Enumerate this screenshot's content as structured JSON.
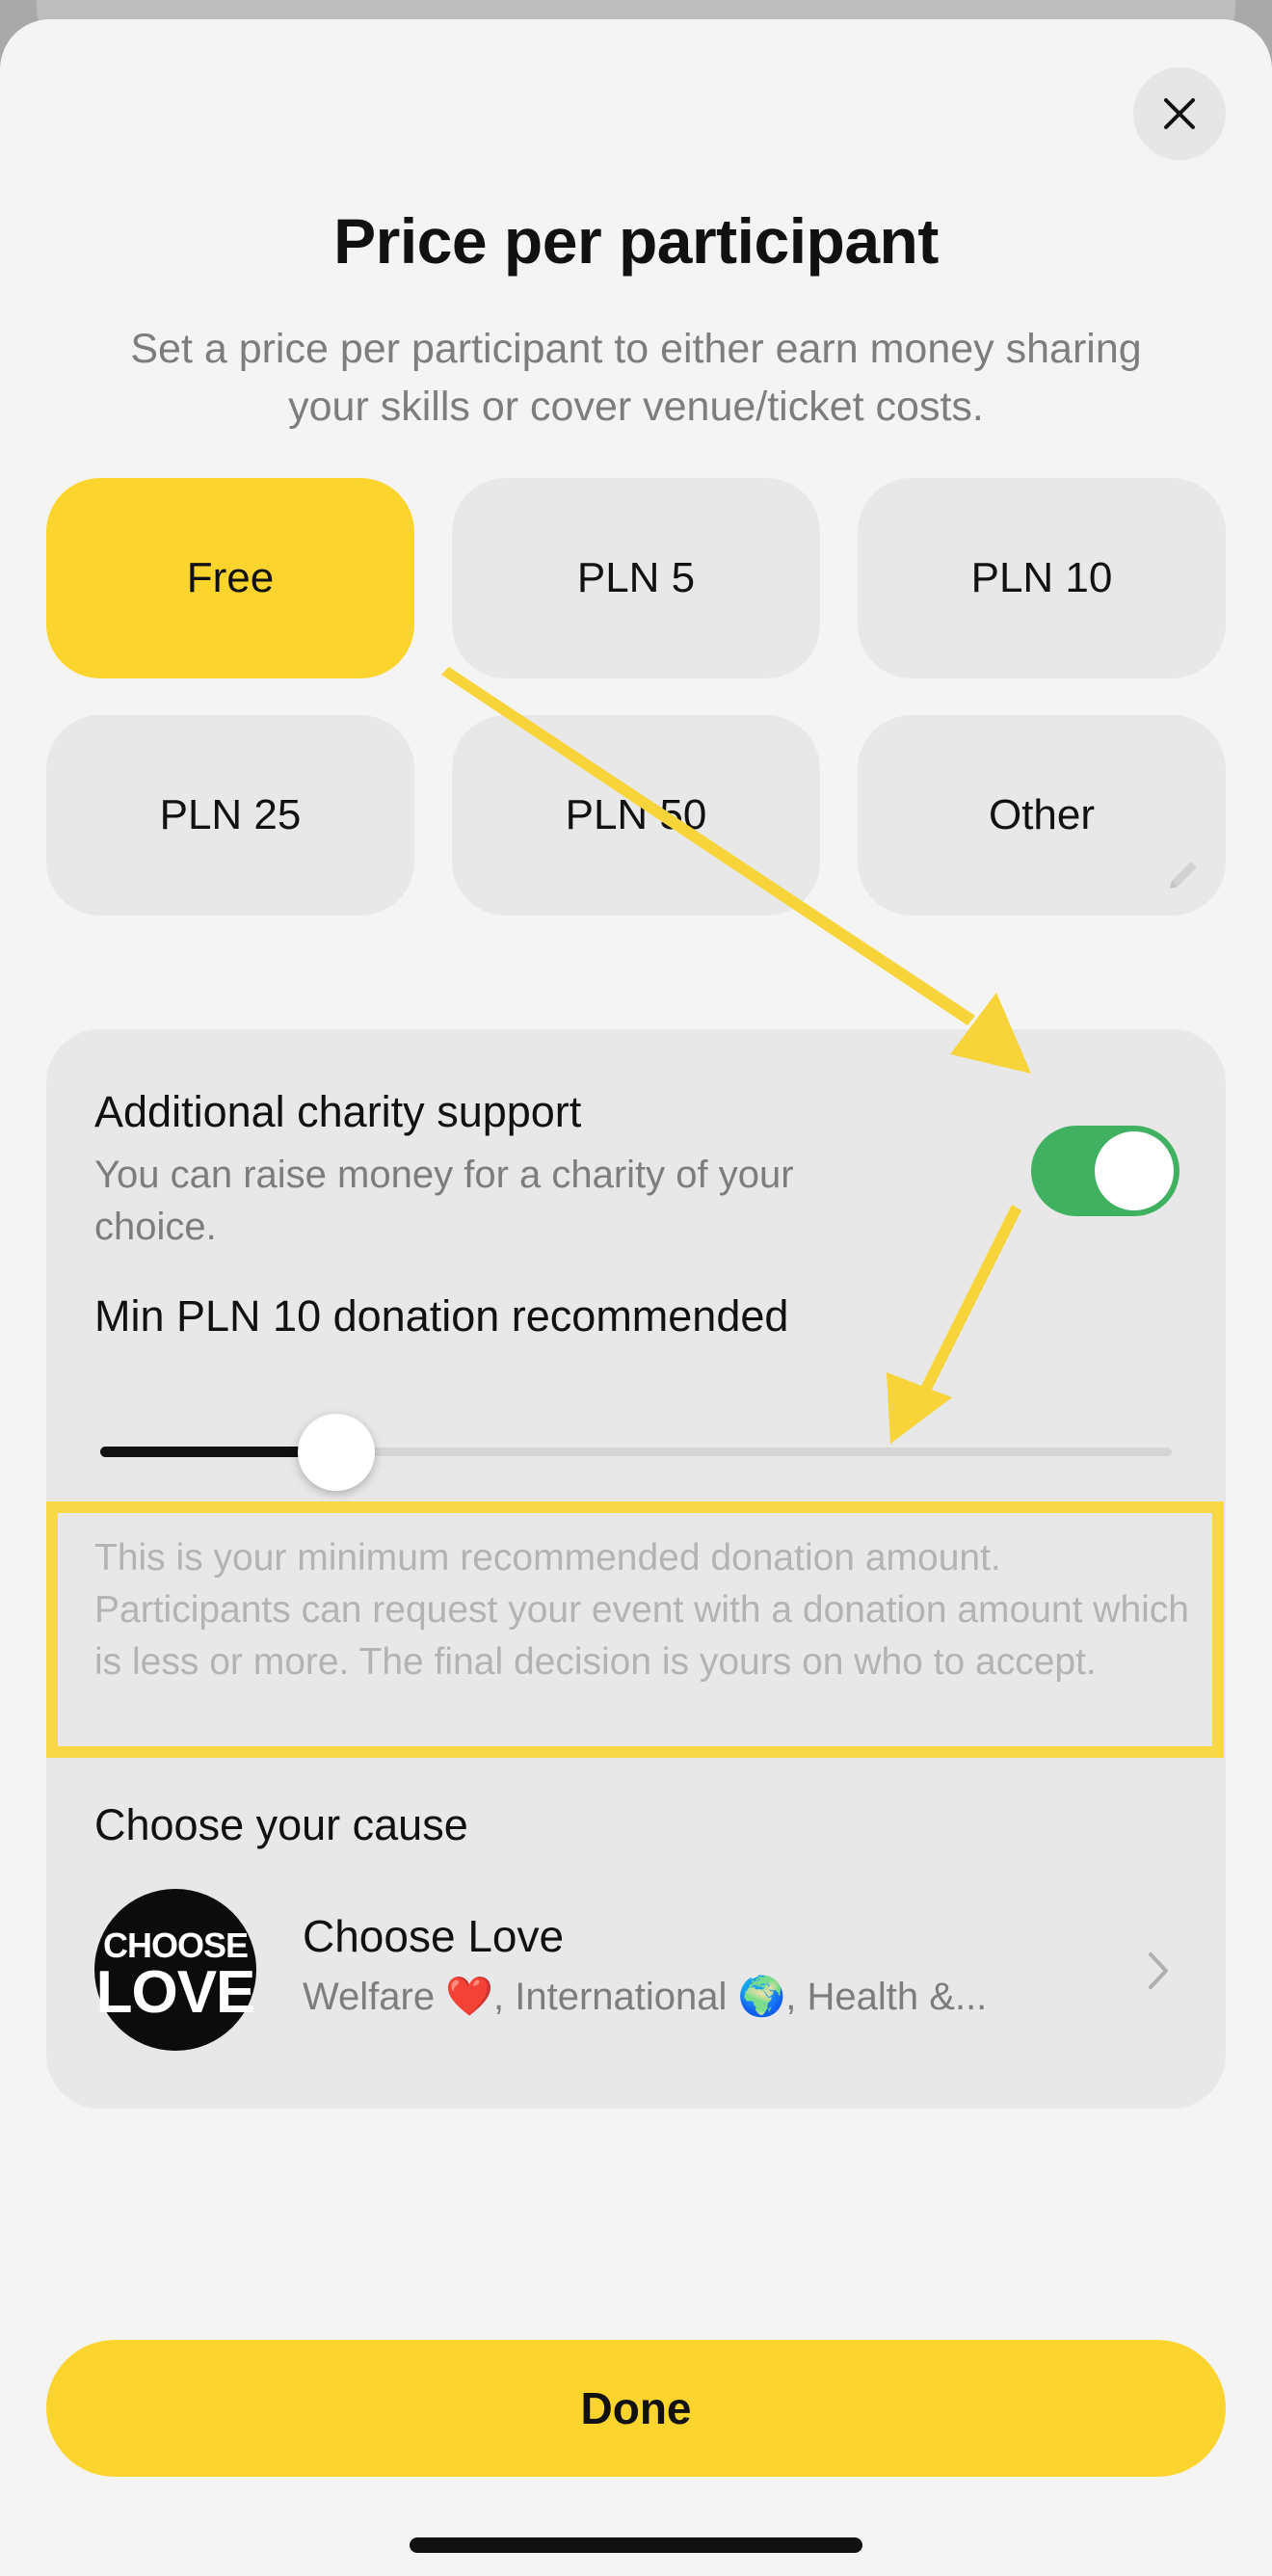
{
  "header": {
    "title": "Price per participant",
    "subtitle": "Set a price per participant to either earn money sharing your skills or cover venue/ticket costs."
  },
  "price_options": [
    {
      "label": "Free",
      "selected": true
    },
    {
      "label": "PLN 5",
      "selected": false
    },
    {
      "label": "PLN 10",
      "selected": false
    },
    {
      "label": "PLN 25",
      "selected": false
    },
    {
      "label": "PLN 50",
      "selected": false
    },
    {
      "label": "Other",
      "selected": false
    }
  ],
  "charity": {
    "title": "Additional charity support",
    "description": "You can raise money for a charity of your choice.",
    "toggle_on": true,
    "min_label": "Min PLN 10 donation recommended",
    "slider_fraction": 0.22,
    "info": "This is your minimum recommended donation amount. Participants can request your event with a donation amount which is less or more. The final decision is yours on who to accept.",
    "cause_label": "Choose your cause",
    "cause": {
      "logo_line1": "CHOOSE",
      "logo_line2": "LOVE",
      "name": "Choose Love",
      "tags": "Welfare ❤️, International 🌍, Health &..."
    }
  },
  "footer": {
    "done_label": "Done"
  },
  "colors": {
    "accent": "#fcd42e",
    "toggle_on": "#3fb161",
    "annotation": "#f8d846"
  }
}
